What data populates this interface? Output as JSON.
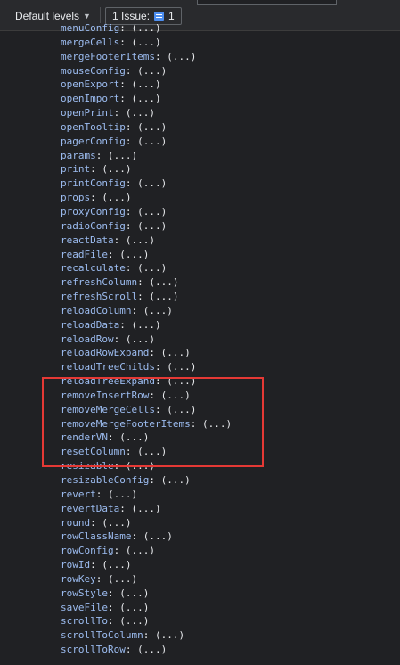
{
  "toolbar": {
    "levels_label": "Default levels",
    "issues_label": "1 Issue:",
    "issues_count": "1"
  },
  "value_placeholder": "(...)",
  "properties": [
    "menuConfig",
    "mergeCells",
    "mergeFooterItems",
    "mouseConfig",
    "openExport",
    "openImport",
    "openPrint",
    "openTooltip",
    "pagerConfig",
    "params",
    "print",
    "printConfig",
    "props",
    "proxyConfig",
    "radioConfig",
    "reactData",
    "readFile",
    "recalculate",
    "refreshColumn",
    "refreshScroll",
    "reloadColumn",
    "reloadData",
    "reloadRow",
    "reloadRowExpand",
    "reloadTreeChilds",
    "reloadTreeExpand",
    "removeInsertRow",
    "removeMergeCells",
    "removeMergeFooterItems",
    "renderVN",
    "resetColumn",
    "resizable",
    "resizableConfig",
    "revert",
    "revertData",
    "round",
    "rowClassName",
    "rowConfig",
    "rowId",
    "rowKey",
    "rowStyle",
    "saveFile",
    "scrollTo",
    "scrollToColumn",
    "scrollToRow"
  ],
  "highlight_color": "#e53935"
}
